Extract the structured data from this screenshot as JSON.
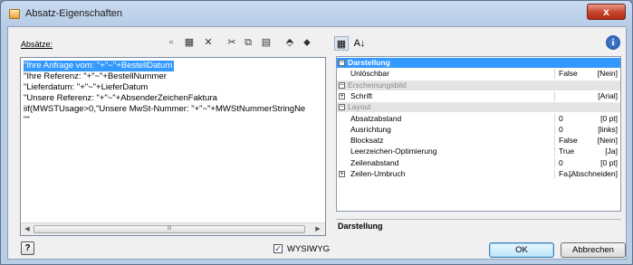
{
  "window": {
    "title": "Absatz-Eigenschaften",
    "close_glyph": "x"
  },
  "left": {
    "label": "Absätze:",
    "toolbar": [
      {
        "name": "new-icon",
        "glyph": "▫"
      },
      {
        "name": "properties-icon",
        "glyph": "▦"
      },
      {
        "name": "delete-icon",
        "glyph": "✕"
      },
      {
        "name": "cut-icon",
        "glyph": "✂"
      },
      {
        "name": "copy-icon",
        "glyph": "⧉"
      },
      {
        "name": "paste-icon",
        "glyph": "▤"
      },
      {
        "name": "move-up-icon",
        "glyph": "⬘"
      },
      {
        "name": "move-down-icon",
        "glyph": "⬥"
      }
    ],
    "lines": [
      "\"Ihre Anfrage vom: \"+\"~\"+BestellDatum",
      "\"Ihre Referenz: \"+\"~\"+BestellNummer",
      "\"Lieferdatum: \"+\"~\"+LieferDatum",
      "\"Unsere Referenz: \"+\"~\"+AbsenderZeichenFaktura",
      "iif(MWSTUsage>0,\"Unsere MwSt-Nummer: \"+\"~\"+MWStNummerStringNe",
      "\"\""
    ],
    "scroll_thumb_grip": "III"
  },
  "right": {
    "sort_cat_glyph": "▦",
    "sort_alpha_glyph": "A↓",
    "info_glyph": "i",
    "rows": [
      {
        "type": "cat",
        "toggle": "−",
        "label": "Darstellung",
        "selected": true
      },
      {
        "type": "prop",
        "label": "Unlöschbar",
        "v1": "False",
        "v2": "[Nein]"
      },
      {
        "type": "cat",
        "toggle": "−",
        "label": "Erscheinungsbild",
        "dim": true
      },
      {
        "type": "prop",
        "toggle": "+",
        "label": "Schrift",
        "v1": "",
        "v2": "[Arial]"
      },
      {
        "type": "cat",
        "toggle": "−",
        "label": "Layout",
        "dim": true
      },
      {
        "type": "prop",
        "label": "Absatzabstand",
        "v1": "0",
        "v2": "[0 pt]"
      },
      {
        "type": "prop",
        "label": "Ausrichtung",
        "v1": "0",
        "v2": "[links]"
      },
      {
        "type": "prop",
        "label": "Blocksatz",
        "v1": "False",
        "v2": "[Nein]"
      },
      {
        "type": "prop",
        "label": "Leerzeichen-Optimierung",
        "v1": "True",
        "v2": "[Ja]"
      },
      {
        "type": "prop",
        "label": "Zeilenabstand",
        "v1": "0",
        "v2": "[0 pt]"
      },
      {
        "type": "prop",
        "toggle": "+",
        "label": "Zeilen-Umbruch",
        "v1": "Fa...",
        "v2": "[Abschneiden]"
      }
    ],
    "description_title": "Darstellung"
  },
  "footer": {
    "help_glyph": "?",
    "wysiwyg_label": "WYSIWYG",
    "wysiwyg_checked": "✓",
    "ok_label": "OK",
    "cancel_label": "Abbrechen"
  }
}
